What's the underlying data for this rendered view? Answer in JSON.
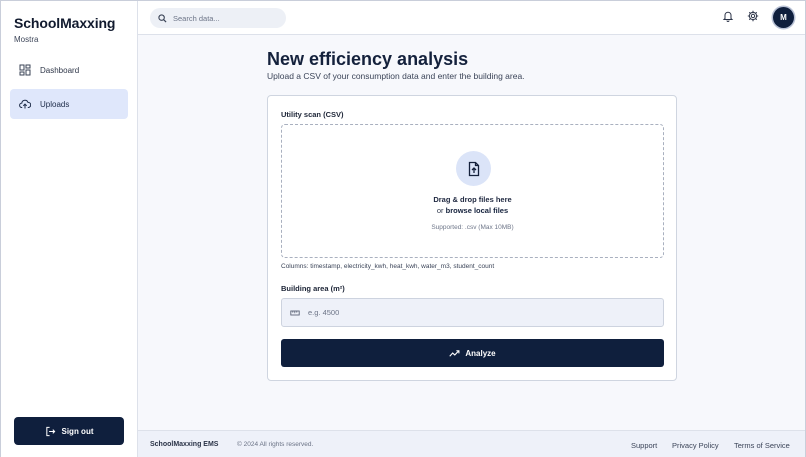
{
  "brand": {
    "title": "SchoolMaxxing",
    "subtitle": "Mostra"
  },
  "sidebar": {
    "items": [
      {
        "label": "Dashboard",
        "icon": "dashboard-grid-icon",
        "active": false
      },
      {
        "label": "Uploads",
        "icon": "cloud-upload-icon",
        "active": true
      }
    ],
    "signout_label": "Sign out"
  },
  "header": {
    "search_placeholder": "Search data...",
    "avatar_initial": "M",
    "icons": [
      "bell-icon",
      "gear-icon"
    ]
  },
  "main": {
    "title": "New efficiency analysis",
    "subtitle": "Upload a CSV of your consumption data and enter the building area.",
    "csv_label": "Utility scan (CSV)",
    "dropzone": {
      "line1": "Drag & drop files here",
      "line2_prefix": "or",
      "line2_link": "browse local files",
      "supported": "Supported: .csv (Max 10MB)"
    },
    "columns_hint": "Columns: timestamp, electricity_kwh, heat_kwh, water_m3, student_count",
    "area_label": "Building area (m²)",
    "area_placeholder": "e.g. 4500",
    "analyze_label": "Analyze"
  },
  "footer": {
    "brand": "SchoolMaxxing EMS",
    "copyright": "© 2024 All rights reserved.",
    "links": [
      "Support",
      "Privacy Policy",
      "Terms of Service"
    ]
  },
  "colors": {
    "primary": "#0f1f3d",
    "active_nav": "#dfe7fb",
    "background": "#f7f8fc"
  }
}
